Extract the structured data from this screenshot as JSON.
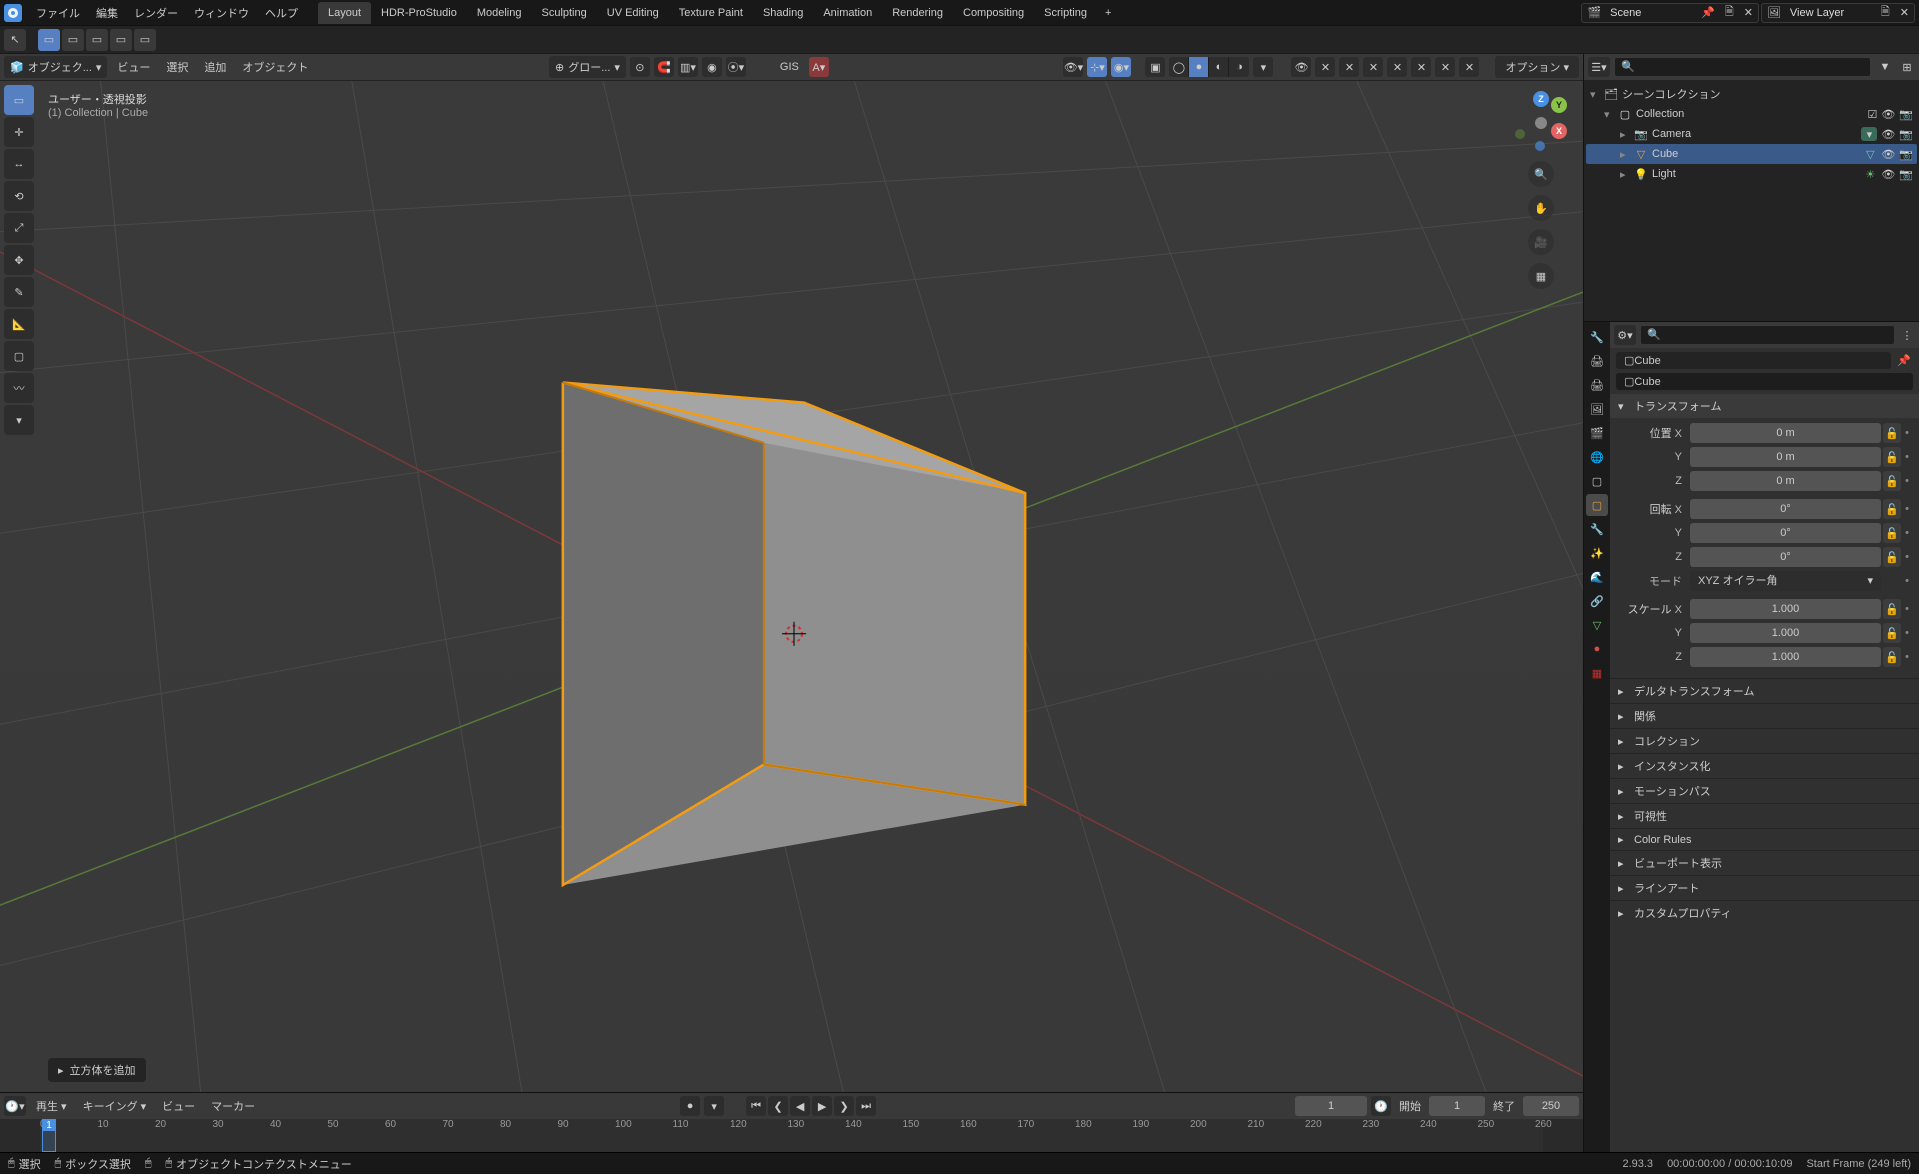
{
  "menubar": {
    "menus": [
      "ファイル",
      "編集",
      "レンダー",
      "ウィンドウ",
      "ヘルプ"
    ],
    "tabs": [
      "Layout",
      "HDR-ProStudio",
      "Modeling",
      "Sculpting",
      "UV Editing",
      "Texture Paint",
      "Shading",
      "Animation",
      "Rendering",
      "Compositing",
      "Scripting"
    ],
    "active_tab": 0,
    "scene_label": "Scene",
    "layer_label": "View Layer"
  },
  "viewport_header": {
    "mode": "オブジェク...",
    "menus": [
      "ビュー",
      "選択",
      "追加",
      "オブジェクト"
    ],
    "global": "グロー...",
    "options": "オプション",
    "gis": "GIS"
  },
  "viewport_info": {
    "line1": "ユーザー・透視投影",
    "line2": "(1) Collection | Cube"
  },
  "operator_popup": "立方体を追加",
  "outliner": {
    "root": "シーンコレクション",
    "collection": "Collection",
    "items": [
      "Camera",
      "Cube",
      "Light"
    ],
    "selected": 1
  },
  "properties": {
    "object_name": "Cube",
    "datablock_name": "Cube",
    "panels": {
      "transform": "トランスフォーム",
      "delta": "デルタトランスフォーム",
      "relations": "関係",
      "collections": "コレクション",
      "instancing": "インスタンス化",
      "motion_paths": "モーションパス",
      "visibility": "可視性",
      "color_rules": "Color Rules",
      "viewport_display": "ビューポート表示",
      "lineart": "ラインアート",
      "custom_props": "カスタムプロパティ"
    },
    "transform": {
      "location_label": "位置",
      "rotation_label": "回転",
      "scale_label": "スケール",
      "mode_label": "モード",
      "mode_value": "XYZ オイラー角",
      "location": {
        "X": "0 m",
        "Y": "0 m",
        "Z": "0 m"
      },
      "rotation": {
        "X": "0°",
        "Y": "0°",
        "Z": "0°"
      },
      "scale": {
        "X": "1.000",
        "Y": "1.000",
        "Z": "1.000"
      }
    }
  },
  "timeline": {
    "menus": [
      "再生",
      "キーイング",
      "ビュー",
      "マーカー"
    ],
    "current": "1",
    "start_label": "開始",
    "start": "1",
    "end_label": "終了",
    "end": "250",
    "ticks": [
      0,
      10,
      20,
      30,
      40,
      50,
      60,
      70,
      80,
      90,
      100,
      110,
      120,
      130,
      140,
      150,
      160,
      170,
      180,
      190,
      200,
      210,
      220,
      230,
      240,
      250,
      260
    ]
  },
  "statusbar": {
    "hints": [
      "選択",
      "ボックス選択",
      "オブジェクトコンテクストメニュー"
    ],
    "version": "2.93.3",
    "time": "00:00:00:00 / 00:00:10:09",
    "frames": "Start Frame (249 left)"
  }
}
